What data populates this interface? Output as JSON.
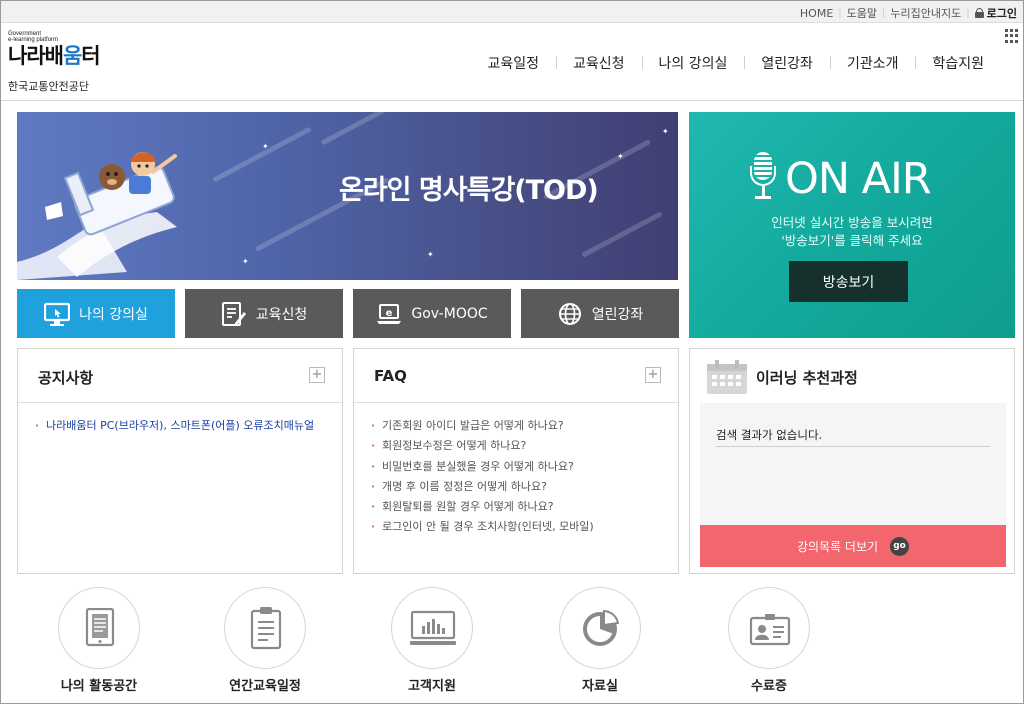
{
  "util_nav": {
    "home": "HOME",
    "help": "도움말",
    "guide": "누리집안내지도",
    "login": "로그인"
  },
  "logo": {
    "small_line1": "Government",
    "small_line2": "e-learning platform",
    "title_part1": "나라배",
    "title_part2": "움",
    "title_part3": "터",
    "org": "한국교통안전공단"
  },
  "gnb": [
    "교육일정",
    "교육신청",
    "나의 강의실",
    "열린강좌",
    "기관소개",
    "학습지원"
  ],
  "banner": {
    "title": "온라인 명사특강(TOD)"
  },
  "onair": {
    "title": "ON AIR",
    "desc_line1": "인터넷 실시간 방송을 보시려면",
    "desc_line2": "'방송보기'를 클릭해 주세요",
    "button": "방송보기",
    "colors": {
      "bg": "#15a99d",
      "button": "#16302e"
    }
  },
  "quick": [
    {
      "label": "나의 강의실",
      "icon": "monitor-icon",
      "color": "#1fa1de"
    },
    {
      "label": "교육신청",
      "icon": "form-pen-icon",
      "color": "#5a5a5a"
    },
    {
      "label": "Gov-MOOC",
      "icon": "laptop-e-icon",
      "color": "#5a5a5a"
    },
    {
      "label": "열린강좌",
      "icon": "globe-icon",
      "color": "#5a5a5a"
    }
  ],
  "notice": {
    "title": "공지사항",
    "plus": "+",
    "items": [
      "나라배움터 PC(브라우저), 스마트폰(어플) 오류조치매뉴얼"
    ]
  },
  "faq": {
    "title": "FAQ",
    "plus": "+",
    "items": [
      "기존회원 아이디 발급은 어떻게 하나요?",
      "회원정보수정은 어떻게 하나요?",
      "비밀번호를 분실했을 경우 어떻게 하나요?",
      "개명 후 이름 정정은 어떻게 하나요?",
      "회원탈퇴를 원할 경우 어떻게 하나요?",
      "로그인이 안 될 경우 조치사항(인터넷, 모바일)"
    ]
  },
  "elearning": {
    "title": "이러닝 추천과정",
    "empty": "검색 결과가 없습니다.",
    "more": "강의목록 더보기",
    "go": "go",
    "more_color": "#f3666e"
  },
  "bottom": [
    {
      "label": "나의 활동공간",
      "icon": "tablet-doc-icon"
    },
    {
      "label": "연간교육일정",
      "icon": "clipboard-icon"
    },
    {
      "label": "고객지원",
      "icon": "monitor-chart-icon"
    },
    {
      "label": "자료실",
      "icon": "pie-chart-icon"
    },
    {
      "label": "수료증",
      "icon": "id-card-icon"
    }
  ]
}
